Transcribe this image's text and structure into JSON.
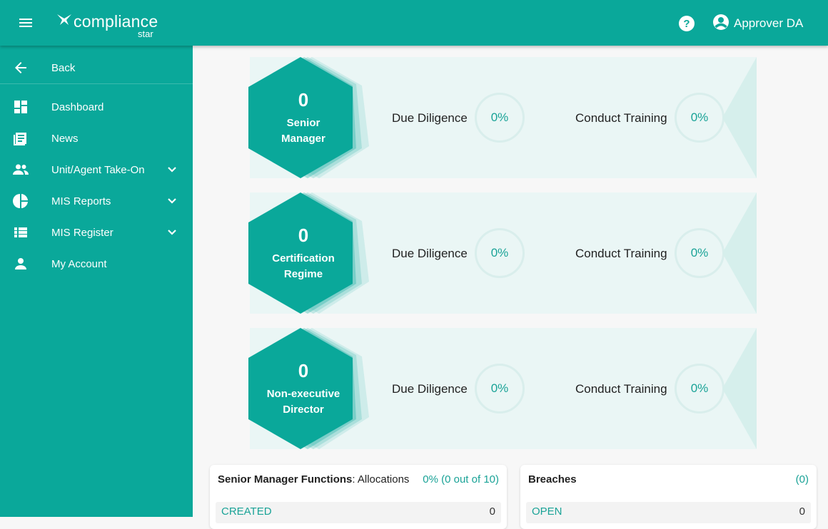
{
  "app": {
    "logo_word": "compliance",
    "logo_sub": "star"
  },
  "header": {
    "user_name": "Approver DA"
  },
  "sidebar": {
    "items": [
      {
        "label": "Back",
        "icon": "arrow-back-icon"
      },
      {
        "label": "Dashboard",
        "icon": "dashboard-icon"
      },
      {
        "label": "News",
        "icon": "news-icon"
      },
      {
        "label": "Unit/Agent Take-On",
        "icon": "people-icon",
        "expandable": true
      },
      {
        "label": "MIS Reports",
        "icon": "pie-chart-icon",
        "expandable": true
      },
      {
        "label": "MIS Register",
        "icon": "list-icon",
        "expandable": true
      },
      {
        "label": "My Account",
        "icon": "person-icon"
      }
    ]
  },
  "banners": [
    {
      "count": "0",
      "label": "Senior Manager",
      "metric1_label": "Due Diligence",
      "metric1_value": "0%",
      "metric2_label": "Conduct Training",
      "metric2_value": "0%"
    },
    {
      "count": "0",
      "label": "Certification Regime",
      "metric1_label": "Due Diligence",
      "metric1_value": "0%",
      "metric2_label": "Conduct Training",
      "metric2_value": "0%"
    },
    {
      "count": "0",
      "label": "Non-executive Director",
      "metric1_label": "Due Diligence",
      "metric1_value": "0%",
      "metric2_label": "Conduct Training",
      "metric2_value": "0%"
    }
  ],
  "cards": [
    {
      "title_bold": "Senior Manager Functions",
      "title_rest": ": Allocations",
      "summary": "0% (0 out of 10)",
      "row_key": "CREATED",
      "row_value": "0"
    },
    {
      "title_bold": "Breaches",
      "title_rest": "",
      "summary": "(0)",
      "row_key": "OPEN",
      "row_value": "0"
    }
  ],
  "colors": {
    "primary": "#0aa89a",
    "banner_bg": "#eaf6f5",
    "accent_text": "#1aa397"
  }
}
